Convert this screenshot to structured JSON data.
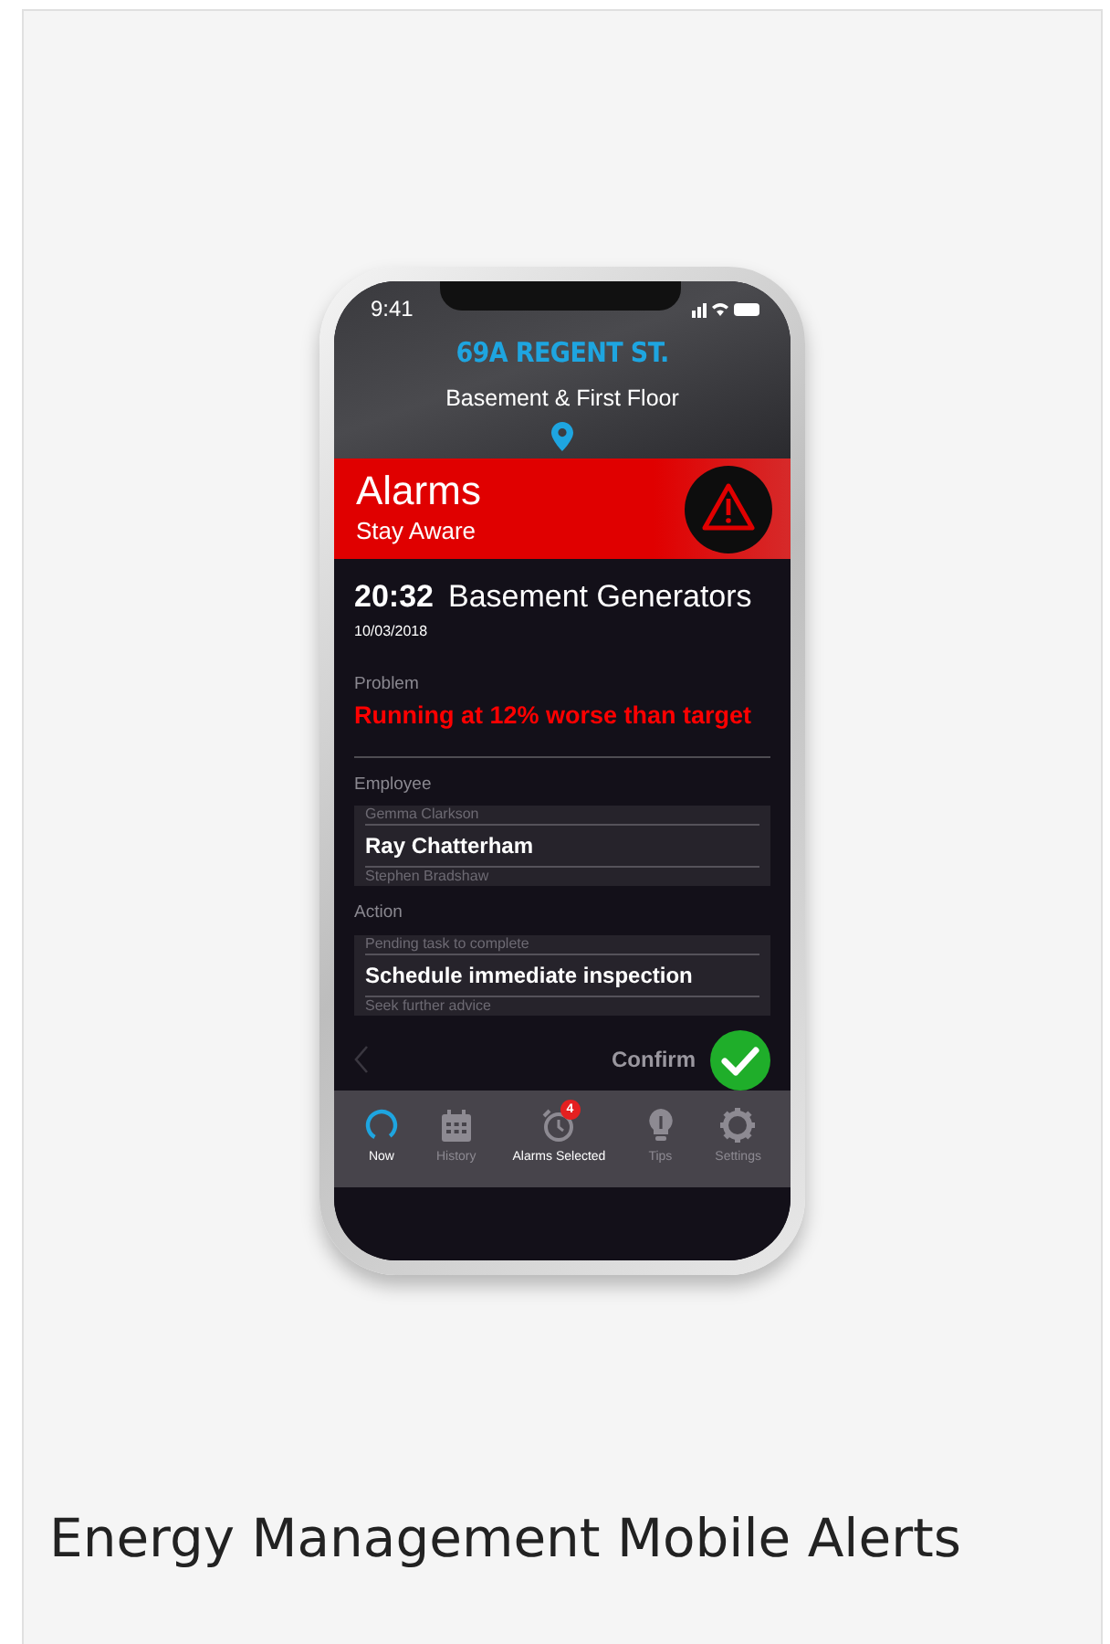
{
  "status_bar": {
    "time": "9:41"
  },
  "header": {
    "address": "69A REGENT ST.",
    "floor": "Basement & First Floor"
  },
  "banner": {
    "title": "Alarms",
    "subtitle": "Stay Aware"
  },
  "alarm": {
    "time": "20:32",
    "date": "10/03/2018",
    "title": "Basement Generators"
  },
  "problem": {
    "label": "Problem",
    "text": "Running at 12% worse than target"
  },
  "pickers": [
    {
      "label": "Employee",
      "options": [
        {
          "text": "Gemma Clarkson",
          "selected": false
        },
        {
          "text": "Ray Chatterham",
          "selected": true
        },
        {
          "text": "Stephen Bradshaw",
          "selected": false
        }
      ]
    },
    {
      "label": "Action",
      "options": [
        {
          "text": "Pending task to complete",
          "selected": false
        },
        {
          "text": "Schedule immediate inspection",
          "selected": true
        },
        {
          "text": "Seek further advice",
          "selected": false
        }
      ]
    }
  ],
  "confirm": {
    "label": "Confirm"
  },
  "tabs": [
    {
      "kind": "now",
      "label": "Now",
      "selected": true
    },
    {
      "kind": "history",
      "label": "History",
      "selected": false
    },
    {
      "kind": "alarms",
      "label": "Alarms Selected",
      "selected": true,
      "badge": "4"
    },
    {
      "kind": "tips",
      "label": "Tips",
      "selected": false
    },
    {
      "kind": "settings",
      "label": "Settings",
      "selected": false
    }
  ],
  "caption": "Energy Management Mobile Alerts"
}
